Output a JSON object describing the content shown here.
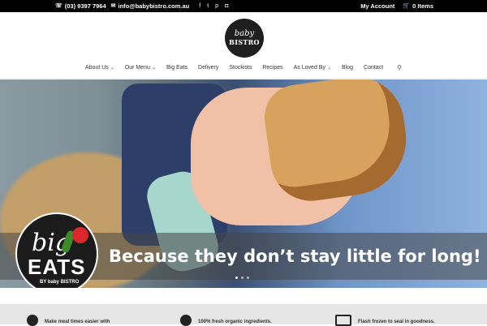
{
  "topbar": {
    "phone": "(03) 9397 7964",
    "email": "info@babybistro.com.au",
    "social_icons": [
      "facebook-icon",
      "twitter-icon",
      "pinterest-icon",
      "instagram-icon"
    ],
    "account_label": "My Account",
    "cart_label": "0 Items"
  },
  "logo": {
    "line1": "baby",
    "line2": "BISTRO"
  },
  "nav": {
    "items": [
      {
        "label": "About Us",
        "dropdown": true
      },
      {
        "label": "Our Menu",
        "dropdown": true
      },
      {
        "label": "Big Eats",
        "dropdown": false
      },
      {
        "label": "Delivery",
        "dropdown": false
      },
      {
        "label": "Stockists",
        "dropdown": false
      },
      {
        "label": "Recipes",
        "dropdown": false
      },
      {
        "label": "As Loved By",
        "dropdown": true
      },
      {
        "label": "Blog",
        "dropdown": false
      },
      {
        "label": "Contact",
        "dropdown": false
      }
    ]
  },
  "hero": {
    "tagline": "Because they don’t stay little for long!",
    "badge": {
      "big": "big",
      "eats": "EATS",
      "by": "BY baby BISTRO"
    },
    "slides": 3,
    "active_slide": 1
  },
  "features": [
    {
      "text": "Make meal times easier with"
    },
    {
      "text": "100% fresh organic ingredients."
    },
    {
      "text": "Flash frozen to seal in goodness."
    }
  ],
  "colors": {
    "topbar": "#000000",
    "features_bg": "#e6e6e6"
  }
}
